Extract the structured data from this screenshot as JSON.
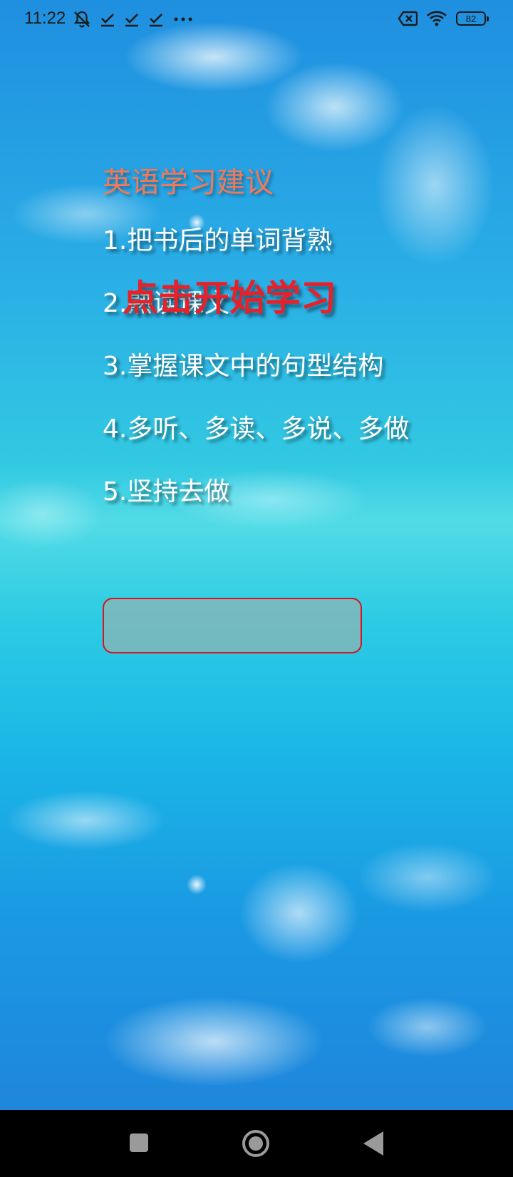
{
  "status_bar": {
    "time": "11:22",
    "battery_level": "82",
    "left_icons": [
      "mute-icon",
      "check-icon",
      "check-icon",
      "check-icon",
      "more-icon"
    ],
    "right_icons": [
      "sim-error-icon",
      "wifi-icon",
      "battery-icon"
    ]
  },
  "main": {
    "title": "英语学习建议",
    "tips": [
      "1.把书后的单词背熟",
      "2.熟读课文",
      "3.掌握课文中的句型结构",
      "4.多听、多读、多说、多做",
      "5.坚持去做"
    ],
    "start_label": "点击开始学习",
    "start_button_label": ""
  },
  "colors": {
    "title": "#f2785a",
    "tip_text": "#ffffff",
    "start_label": "#e8202a",
    "button_border": "#d8141c"
  },
  "nav_bar": {
    "buttons": [
      "recents-icon",
      "home-icon",
      "back-icon"
    ]
  }
}
